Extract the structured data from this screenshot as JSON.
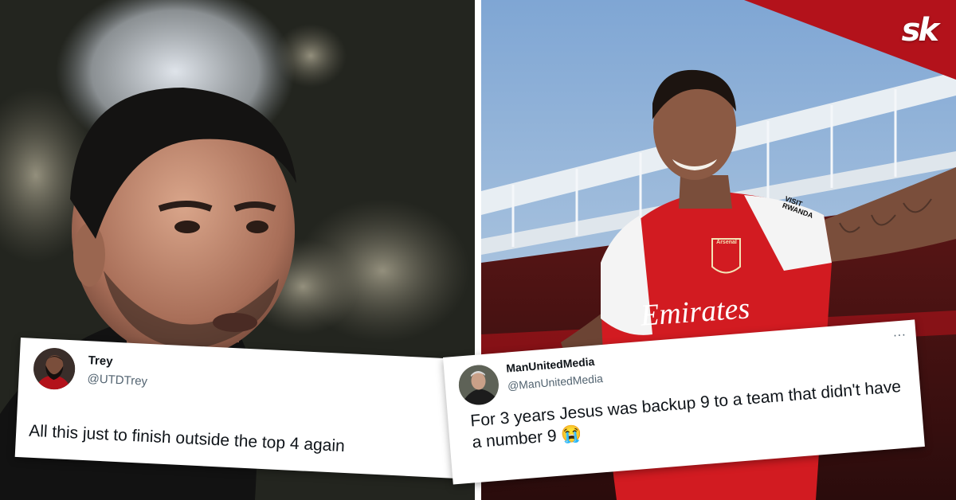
{
  "brand": {
    "logo_text": "sk"
  },
  "left_image": {
    "subject": "manager-photo"
  },
  "right_image": {
    "subject": "player-in-arsenal-kit",
    "shirt_sponsor": "Emirates",
    "badge_text": "Arsenal",
    "sleeve_text": "VISIT RWANDA"
  },
  "tweets": [
    {
      "name": "Trey",
      "handle": "@UTDTrey",
      "text": "All this just to finish outside the top 4 again"
    },
    {
      "name": "ManUnitedMedia",
      "handle": "@ManUnitedMedia",
      "text": "For 3 years Jesus was backup 9 to a team that didn't have a number 9 😭",
      "menu": "..."
    }
  ]
}
